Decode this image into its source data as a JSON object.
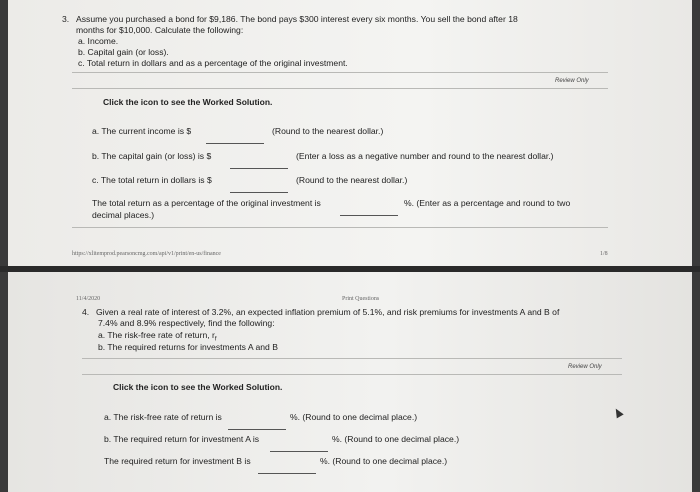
{
  "q3": {
    "number": "3.",
    "text1": "Assume you purchased a bond for $9,186. The bond pays $300 interest every six months. You sell the bond after 18",
    "text2": "months for $10,000. Calculate the following:",
    "items": [
      "a. Income.",
      "b. Capital gain (or loss).",
      "c. Total return in dollars and as a percentage of the original investment."
    ],
    "review": "Review Only",
    "worked": "Click the icon to see the Worked Solution.",
    "a_label": "a. The current income is $",
    "a_hint": "(Round to the nearest dollar.)",
    "b_label": "b. The capital gain (or loss) is $",
    "b_hint": "(Enter a loss as a negative number and round to the nearest dollar.)",
    "c_label": "c. The total return in dollars is $",
    "c_hint": "(Round to the nearest dollar.)",
    "pct_line1": "The total return as a percentage of the original investment is",
    "pct_hint": "%. (Enter as a percentage and round to two",
    "pct_line2": "decimal places.)"
  },
  "footer_url": "https://xlitemprod.pearsoncmg.com/api/v1/print/en-us/finance",
  "footer_page": "1/8",
  "header_date": "11/4/2020",
  "header_title": "Print Questions",
  "q4": {
    "number": "4.",
    "text1": "Given a real rate of interest of 3.2%, an expected inflation premium of 5.1%, and risk premiums for investments A and B of",
    "text2": "7.4% and 8.9% respectively, find the following:",
    "item_a": "a. The risk-free rate of return, r",
    "item_a_sub": "f",
    "item_b": "b. The required returns for investments A and B",
    "review": "Review Only",
    "worked": "Click the icon to see the Worked Solution.",
    "a_label": "a. The risk-free rate of return is",
    "a_hint": "%. (Round to one decimal place.)",
    "b_label": "b. The required return for investment A is",
    "b_hint": "%. (Round to one decimal place.)",
    "c_label": "The required return for investment B is",
    "c_hint": "%. (Round to one decimal place.)"
  }
}
